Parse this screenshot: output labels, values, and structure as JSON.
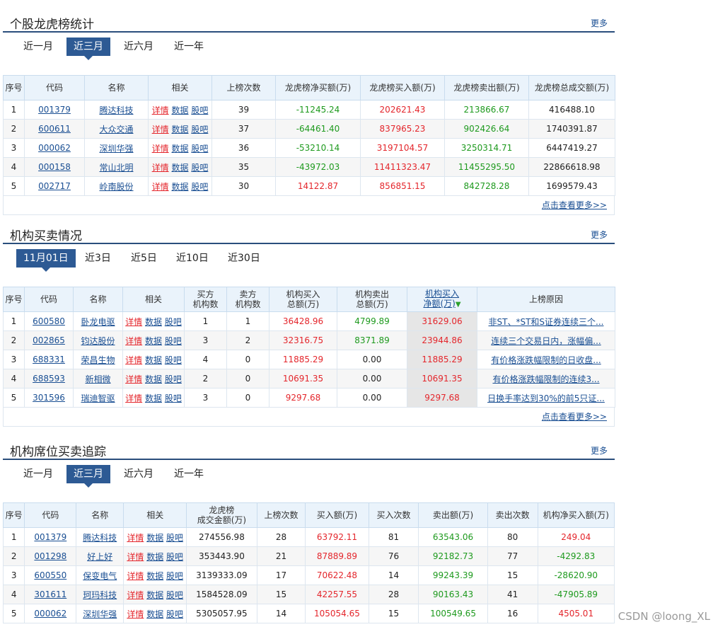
{
  "s1": {
    "title": "个股龙虎榜统计",
    "more": "更多",
    "tabs": [
      "近一月",
      "近三月",
      "近六月",
      "近一年"
    ],
    "headers": [
      "序号",
      "代码",
      "名称",
      "相关",
      "上榜次数",
      "龙虎榜净买额(万)",
      "龙虎榜买入额(万)",
      "龙虎榜卖出额(万)",
      "龙虎榜总成交额(万)"
    ],
    "links": {
      "detail": "详情",
      "data": "数据",
      "bar": "股吧"
    },
    "rows": [
      {
        "idx": "1",
        "code": "001379",
        "name": "腾达科技",
        "count": "39",
        "net": "-11245.24",
        "buy": "202621.43",
        "sell": "213866.67",
        "total": "416488.10"
      },
      {
        "idx": "2",
        "code": "600611",
        "name": "大众交通",
        "count": "37",
        "net": "-64461.40",
        "buy": "837965.23",
        "sell": "902426.64",
        "total": "1740391.87"
      },
      {
        "idx": "3",
        "code": "000062",
        "name": "深圳华强",
        "count": "36",
        "net": "-53210.14",
        "buy": "3197104.57",
        "sell": "3250314.71",
        "total": "6447419.27"
      },
      {
        "idx": "4",
        "code": "000158",
        "name": "常山北明",
        "count": "35",
        "net": "-43972.03",
        "buy": "11411323.47",
        "sell": "11455295.50",
        "total": "22866618.98"
      },
      {
        "idx": "5",
        "code": "002717",
        "name": "岭南股份",
        "count": "30",
        "net": "14122.87",
        "buy": "856851.15",
        "sell": "842728.28",
        "total": "1699579.43"
      }
    ],
    "footer": "点击查看更多>>"
  },
  "s2": {
    "title": "机构买卖情况",
    "more": "更多",
    "tabs": [
      "11月01日",
      "近3日",
      "近5日",
      "近10日",
      "近30日"
    ],
    "headers": [
      "序号",
      "代码",
      "名称",
      "相关",
      "买方\n机构数",
      "卖方\n机构数",
      "机构买入\n总额(万)",
      "机构卖出\n总额(万)",
      "机构买入\n净额(万)",
      "上榜原因"
    ],
    "rows": [
      {
        "idx": "1",
        "code": "600580",
        "name": "卧龙电驱",
        "buyers": "1",
        "sellers": "1",
        "buy": "36428.96",
        "sell": "4799.89",
        "net": "31629.06",
        "reason": "非ST、*ST和S证券连续三个..."
      },
      {
        "idx": "2",
        "code": "002865",
        "name": "钧达股份",
        "buyers": "3",
        "sellers": "2",
        "buy": "32316.75",
        "sell": "8371.89",
        "net": "23944.86",
        "reason": "连续三个交易日内，涨幅偏..."
      },
      {
        "idx": "3",
        "code": "688331",
        "name": "荣昌生物",
        "buyers": "4",
        "sellers": "0",
        "buy": "11885.29",
        "sell": "0.00",
        "net": "11885.29",
        "reason": "有价格涨跌幅限制的日收盘..."
      },
      {
        "idx": "4",
        "code": "688593",
        "name": "新相微",
        "buyers": "2",
        "sellers": "0",
        "buy": "10691.35",
        "sell": "0.00",
        "net": "10691.35",
        "reason": "有价格涨跌幅限制的连续3..."
      },
      {
        "idx": "5",
        "code": "301596",
        "name": "瑞迪智驱",
        "buyers": "3",
        "sellers": "0",
        "buy": "9297.68",
        "sell": "0.00",
        "net": "9297.68",
        "reason": "日换手率达到30%的前5只证..."
      }
    ],
    "footer": "点击查看更多>>"
  },
  "s3": {
    "title": "机构席位买卖追踪",
    "more": "更多",
    "tabs": [
      "近一月",
      "近三月",
      "近六月",
      "近一年"
    ],
    "headers": [
      "序号",
      "代码",
      "名称",
      "相关",
      "龙虎榜\n成交金额(万)",
      "上榜次数",
      "买入额(万)",
      "买入次数",
      "卖出额(万)",
      "卖出次数",
      "机构净买入额(万)"
    ],
    "rows": [
      {
        "idx": "1",
        "code": "001379",
        "name": "腾达科技",
        "amount": "274556.98",
        "count": "28",
        "buy": "63792.11",
        "buycnt": "81",
        "sell": "63543.06",
        "sellcnt": "80",
        "net": "249.04"
      },
      {
        "idx": "2",
        "code": "001298",
        "name": "好上好",
        "amount": "353443.90",
        "count": "21",
        "buy": "87889.89",
        "buycnt": "76",
        "sell": "92182.73",
        "sellcnt": "77",
        "net": "-4292.83"
      },
      {
        "idx": "3",
        "code": "600550",
        "name": "保变电气",
        "amount": "3139333.09",
        "count": "17",
        "buy": "70622.48",
        "buycnt": "14",
        "sell": "99243.39",
        "sellcnt": "15",
        "net": "-28620.90"
      },
      {
        "idx": "4",
        "code": "301611",
        "name": "珂玛科技",
        "amount": "1584528.09",
        "count": "15",
        "buy": "42257.55",
        "buycnt": "28",
        "sell": "90163.43",
        "sellcnt": "41",
        "net": "-47905.89"
      },
      {
        "idx": "5",
        "code": "000062",
        "name": "深圳华强",
        "amount": "5305057.95",
        "count": "14",
        "buy": "105054.65",
        "buycnt": "15",
        "sell": "100549.65",
        "sellcnt": "16",
        "net": "4505.01"
      }
    ]
  },
  "watermark": "CSDN @loong_XL",
  "colors": {
    "accent": "#2d5a94",
    "up": "#e4262c",
    "down": "#1e9a1e",
    "link": "#1a4f93"
  }
}
